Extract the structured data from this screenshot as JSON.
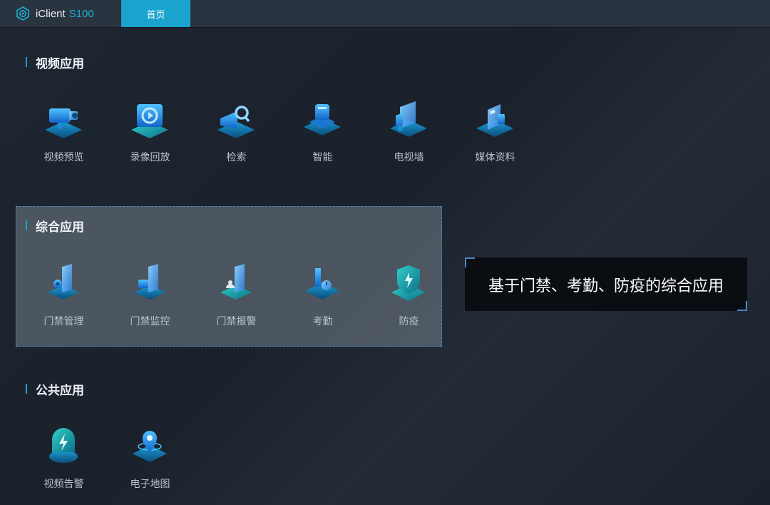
{
  "header": {
    "brand_name": "iClient",
    "brand_model": "S100",
    "home_tab": "首页"
  },
  "sections": {
    "video": {
      "title": "视频应用",
      "items": [
        "视频预览",
        "录像回放",
        "检索",
        "智能",
        "电视墙",
        "媒体资料"
      ]
    },
    "integrated": {
      "title": "综合应用",
      "items": [
        "门禁管理",
        "门禁监控",
        "门禁报警",
        "考勤",
        "防疫"
      ]
    },
    "public": {
      "title": "公共应用",
      "items": [
        "视频告警",
        "电子地图"
      ]
    }
  },
  "tooltip": {
    "text": "基于门禁、考勤、防疫的综合应用"
  },
  "colors": {
    "accent": "#1aa3cc",
    "highlight_border": "#4f86c4",
    "icon_blue": "#1e8fe6",
    "icon_teal": "#1fb3b0"
  }
}
